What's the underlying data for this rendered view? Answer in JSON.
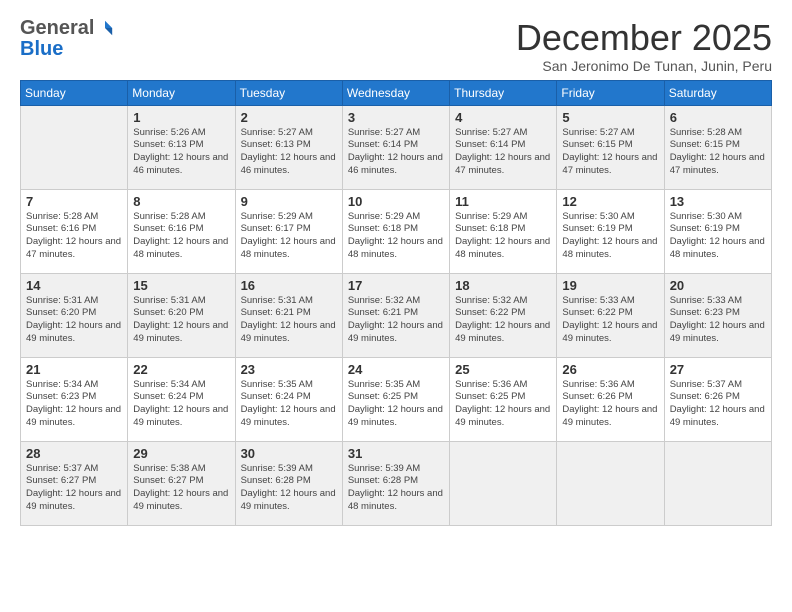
{
  "logo": {
    "general": "General",
    "blue": "Blue"
  },
  "title": "December 2025",
  "subtitle": "San Jeronimo De Tunan, Junin, Peru",
  "days_header": [
    "Sunday",
    "Monday",
    "Tuesday",
    "Wednesday",
    "Thursday",
    "Friday",
    "Saturday"
  ],
  "weeks": [
    [
      {
        "day": "",
        "info": ""
      },
      {
        "day": "1",
        "info": "Sunrise: 5:26 AM\nSunset: 6:13 PM\nDaylight: 12 hours and 46 minutes."
      },
      {
        "day": "2",
        "info": "Sunrise: 5:27 AM\nSunset: 6:13 PM\nDaylight: 12 hours and 46 minutes."
      },
      {
        "day": "3",
        "info": "Sunrise: 5:27 AM\nSunset: 6:14 PM\nDaylight: 12 hours and 46 minutes."
      },
      {
        "day": "4",
        "info": "Sunrise: 5:27 AM\nSunset: 6:14 PM\nDaylight: 12 hours and 47 minutes."
      },
      {
        "day": "5",
        "info": "Sunrise: 5:27 AM\nSunset: 6:15 PM\nDaylight: 12 hours and 47 minutes."
      },
      {
        "day": "6",
        "info": "Sunrise: 5:28 AM\nSunset: 6:15 PM\nDaylight: 12 hours and 47 minutes."
      }
    ],
    [
      {
        "day": "7",
        "info": "Sunrise: 5:28 AM\nSunset: 6:16 PM\nDaylight: 12 hours and 47 minutes."
      },
      {
        "day": "8",
        "info": "Sunrise: 5:28 AM\nSunset: 6:16 PM\nDaylight: 12 hours and 48 minutes."
      },
      {
        "day": "9",
        "info": "Sunrise: 5:29 AM\nSunset: 6:17 PM\nDaylight: 12 hours and 48 minutes."
      },
      {
        "day": "10",
        "info": "Sunrise: 5:29 AM\nSunset: 6:18 PM\nDaylight: 12 hours and 48 minutes."
      },
      {
        "day": "11",
        "info": "Sunrise: 5:29 AM\nSunset: 6:18 PM\nDaylight: 12 hours and 48 minutes."
      },
      {
        "day": "12",
        "info": "Sunrise: 5:30 AM\nSunset: 6:19 PM\nDaylight: 12 hours and 48 minutes."
      },
      {
        "day": "13",
        "info": "Sunrise: 5:30 AM\nSunset: 6:19 PM\nDaylight: 12 hours and 48 minutes."
      }
    ],
    [
      {
        "day": "14",
        "info": "Sunrise: 5:31 AM\nSunset: 6:20 PM\nDaylight: 12 hours and 49 minutes."
      },
      {
        "day": "15",
        "info": "Sunrise: 5:31 AM\nSunset: 6:20 PM\nDaylight: 12 hours and 49 minutes."
      },
      {
        "day": "16",
        "info": "Sunrise: 5:31 AM\nSunset: 6:21 PM\nDaylight: 12 hours and 49 minutes."
      },
      {
        "day": "17",
        "info": "Sunrise: 5:32 AM\nSunset: 6:21 PM\nDaylight: 12 hours and 49 minutes."
      },
      {
        "day": "18",
        "info": "Sunrise: 5:32 AM\nSunset: 6:22 PM\nDaylight: 12 hours and 49 minutes."
      },
      {
        "day": "19",
        "info": "Sunrise: 5:33 AM\nSunset: 6:22 PM\nDaylight: 12 hours and 49 minutes."
      },
      {
        "day": "20",
        "info": "Sunrise: 5:33 AM\nSunset: 6:23 PM\nDaylight: 12 hours and 49 minutes."
      }
    ],
    [
      {
        "day": "21",
        "info": "Sunrise: 5:34 AM\nSunset: 6:23 PM\nDaylight: 12 hours and 49 minutes."
      },
      {
        "day": "22",
        "info": "Sunrise: 5:34 AM\nSunset: 6:24 PM\nDaylight: 12 hours and 49 minutes."
      },
      {
        "day": "23",
        "info": "Sunrise: 5:35 AM\nSunset: 6:24 PM\nDaylight: 12 hours and 49 minutes."
      },
      {
        "day": "24",
        "info": "Sunrise: 5:35 AM\nSunset: 6:25 PM\nDaylight: 12 hours and 49 minutes."
      },
      {
        "day": "25",
        "info": "Sunrise: 5:36 AM\nSunset: 6:25 PM\nDaylight: 12 hours and 49 minutes."
      },
      {
        "day": "26",
        "info": "Sunrise: 5:36 AM\nSunset: 6:26 PM\nDaylight: 12 hours and 49 minutes."
      },
      {
        "day": "27",
        "info": "Sunrise: 5:37 AM\nSunset: 6:26 PM\nDaylight: 12 hours and 49 minutes."
      }
    ],
    [
      {
        "day": "28",
        "info": "Sunrise: 5:37 AM\nSunset: 6:27 PM\nDaylight: 12 hours and 49 minutes."
      },
      {
        "day": "29",
        "info": "Sunrise: 5:38 AM\nSunset: 6:27 PM\nDaylight: 12 hours and 49 minutes."
      },
      {
        "day": "30",
        "info": "Sunrise: 5:39 AM\nSunset: 6:28 PM\nDaylight: 12 hours and 49 minutes."
      },
      {
        "day": "31",
        "info": "Sunrise: 5:39 AM\nSunset: 6:28 PM\nDaylight: 12 hours and 48 minutes."
      },
      {
        "day": "",
        "info": ""
      },
      {
        "day": "",
        "info": ""
      },
      {
        "day": "",
        "info": ""
      }
    ]
  ]
}
